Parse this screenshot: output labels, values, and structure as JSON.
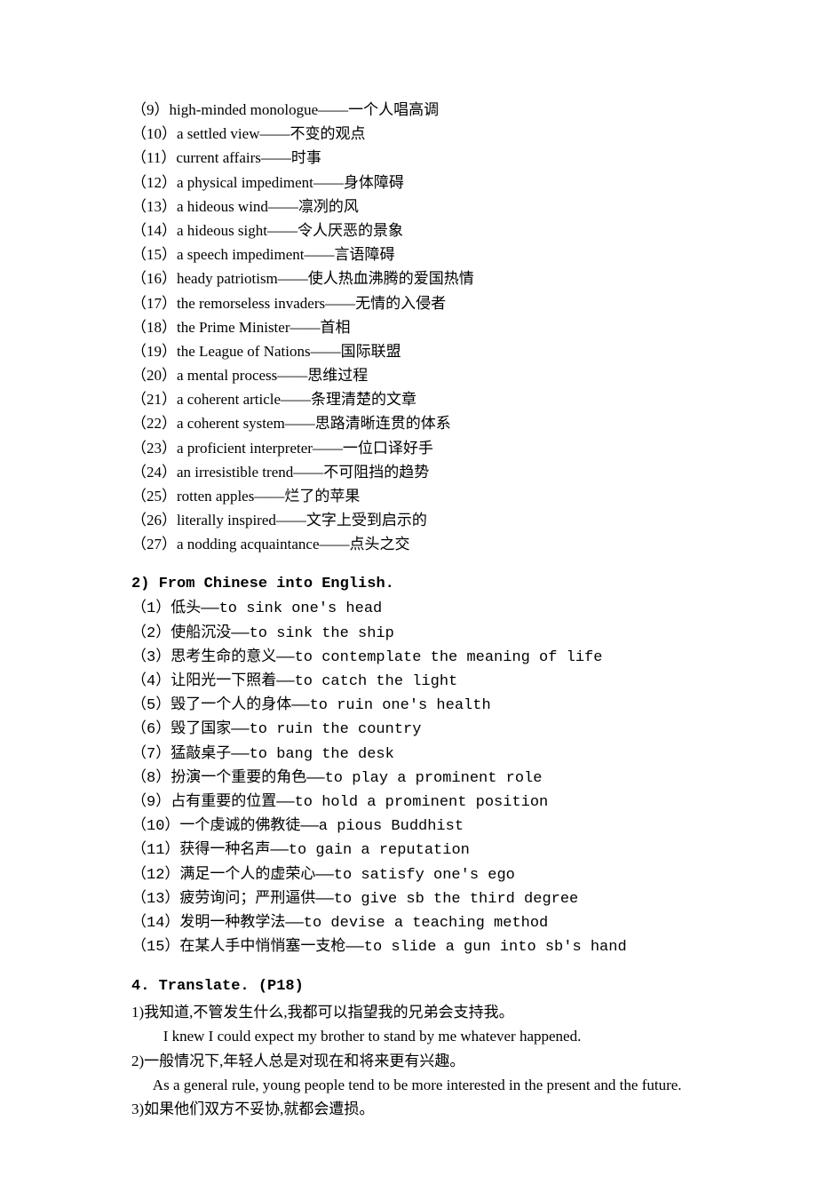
{
  "lines": [
    {
      "type": "entry",
      "num": "（9）",
      "text": "high-minded monologue——一个人唱高调"
    },
    {
      "type": "entry",
      "num": "（10）",
      "text": "a settled view——不变的观点"
    },
    {
      "type": "entry",
      "num": "（11）",
      "text": "current affairs——时事"
    },
    {
      "type": "entry",
      "num": "（12）",
      "text": "a physical impediment——身体障碍"
    },
    {
      "type": "entry",
      "num": "（13）",
      "text": "a hideous wind——凛冽的风"
    },
    {
      "type": "entry",
      "num": "（14）",
      "text": "a hideous sight——令人厌恶的景象"
    },
    {
      "type": "entry",
      "num": "（15）",
      "text": "a speech impediment——言语障碍"
    },
    {
      "type": "entry",
      "num": "（16）",
      "text": "heady patriotism——使人热血沸腾的爱国热情"
    },
    {
      "type": "entry",
      "num": "（17）",
      "text": "the remorseless invaders——无情的入侵者"
    },
    {
      "type": "entry",
      "num": "（18）",
      "text": "the Prime Minister——首相"
    },
    {
      "type": "entry",
      "num": "（19）",
      "text": "the League of Nations——国际联盟"
    },
    {
      "type": "entry",
      "num": "（20）",
      "text": "a mental process——思维过程"
    },
    {
      "type": "entry",
      "num": "（21）",
      "text": "a coherent article——条理清楚的文章"
    },
    {
      "type": "entry",
      "num": "（22）",
      "text": "a coherent system——思路清晰连贯的体系"
    },
    {
      "type": "entry",
      "num": "（23）",
      "text": "a proficient interpreter——一位口译好手"
    },
    {
      "type": "entry",
      "num": "（24）",
      "text": "an irresistible trend——不可阻挡的趋势"
    },
    {
      "type": "entry",
      "num": "（25）",
      "text": "rotten apples——烂了的苹果"
    },
    {
      "type": "entry",
      "num": "（26）",
      "text": "literally inspired——文字上受到启示的"
    },
    {
      "type": "entry",
      "num": "（27）",
      "text": "a nodding acquaintance——点头之交"
    },
    {
      "type": "heading",
      "text": "2) From Chinese into English."
    },
    {
      "type": "mono",
      "num": "（1）",
      "text": "低头——to sink one's head"
    },
    {
      "type": "mono",
      "num": "（2）",
      "text": "使船沉没——to sink the ship"
    },
    {
      "type": "mono",
      "num": "（3）",
      "text": "思考生命的意义——to contemplate the meaning of life"
    },
    {
      "type": "mono",
      "num": "（4）",
      "text": "让阳光一下照着——to catch the light"
    },
    {
      "type": "mono",
      "num": "（5）",
      "text": "毁了一个人的身体——to ruin one's health"
    },
    {
      "type": "mono",
      "num": "（6）",
      "text": "毁了国家——to ruin the country"
    },
    {
      "type": "mono",
      "num": "（7）",
      "text": "猛敲桌子——to bang the desk"
    },
    {
      "type": "mono",
      "num": "（8）",
      "text": "扮演一个重要的角色——to play a prominent role"
    },
    {
      "type": "mono",
      "num": "（9）",
      "text": "占有重要的位置——to hold a prominent position"
    },
    {
      "type": "mono",
      "num": "（10）",
      "text": "一个虔诚的佛教徒——a pious Buddhist"
    },
    {
      "type": "mono",
      "num": "（11）",
      "text": "获得一种名声——to gain a reputation"
    },
    {
      "type": "mono",
      "num": "（12）",
      "text": "满足一个人的虚荣心——to satisfy one's ego"
    },
    {
      "type": "mono",
      "num": "（13）",
      "text": "疲劳询问；严刑逼供——to give sb the third degree"
    },
    {
      "type": "mono",
      "num": "（14）",
      "text": "发明一种教学法——to devise a teaching method"
    },
    {
      "type": "mono",
      "num": "（15）",
      "text": "在某人手中悄悄塞一支枪——to slide a gun into sb's hand"
    },
    {
      "type": "heading4",
      "text": "4. Translate. (P18)"
    },
    {
      "type": "qnum",
      "num": "1)",
      "text": "我知道,不管发生什么,我都可以指望我的兄弟会支持我。"
    },
    {
      "type": "indent",
      "text": "I knew I could expect my brother to stand by me whatever happened."
    },
    {
      "type": "qnum",
      "num": "2)",
      "text": "一般情况下,年轻人总是对现在和将来更有兴趣。"
    },
    {
      "type": "indentwrap",
      "text": "As a general rule, young people tend to be more interested in the present and the future."
    },
    {
      "type": "qnum",
      "num": "3)",
      "text": "如果他们双方不妥协,就都会遭损。"
    }
  ]
}
